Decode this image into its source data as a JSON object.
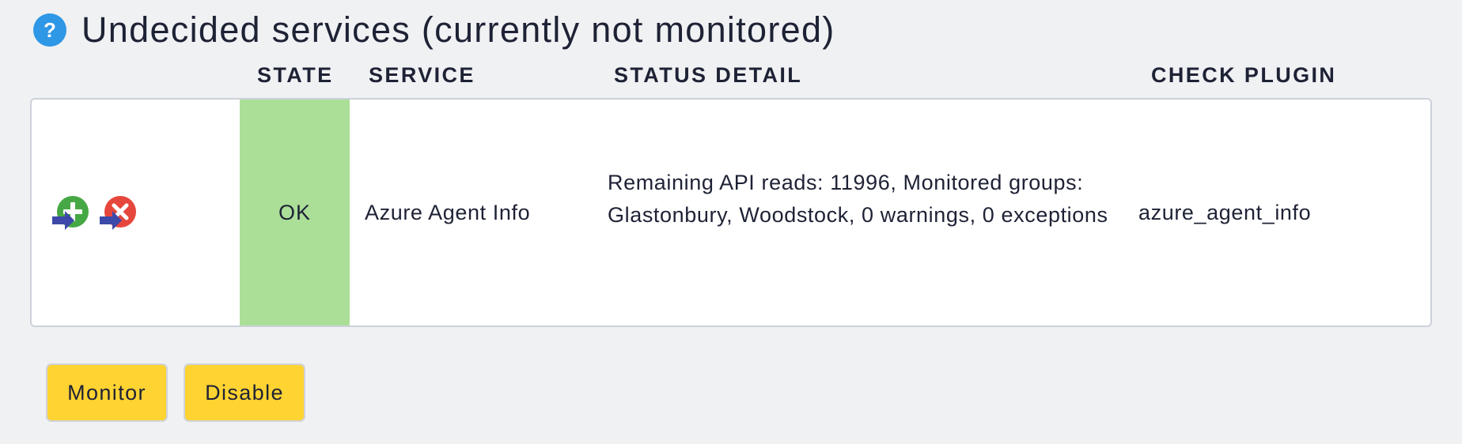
{
  "section": {
    "title": "Undecided services (currently not monitored)",
    "help_icon": "question-mark-icon"
  },
  "table": {
    "columns": [
      "STATE",
      "SERVICE",
      "STATUS DETAIL",
      "CHECK PLUGIN"
    ],
    "rows": [
      {
        "actions": [
          "monitor-service-icon",
          "disable-service-icon"
        ],
        "state": "OK",
        "service": "Azure Agent Info",
        "status_detail": "Remaining API reads: 11996, Monitored groups: Glastonbury, Woodstock, 0 warnings, 0 exceptions",
        "check_plugin": "azure_agent_info"
      }
    ]
  },
  "buttons": {
    "monitor": "Monitor",
    "disable": "Disable"
  },
  "colors": {
    "state_ok": "#abdf98",
    "button": "#ffd331",
    "help_icon": "#2e97e6",
    "monitor_icon": "#46a844",
    "disable_icon": "#e6473d",
    "arrow": "#3d49a8"
  }
}
